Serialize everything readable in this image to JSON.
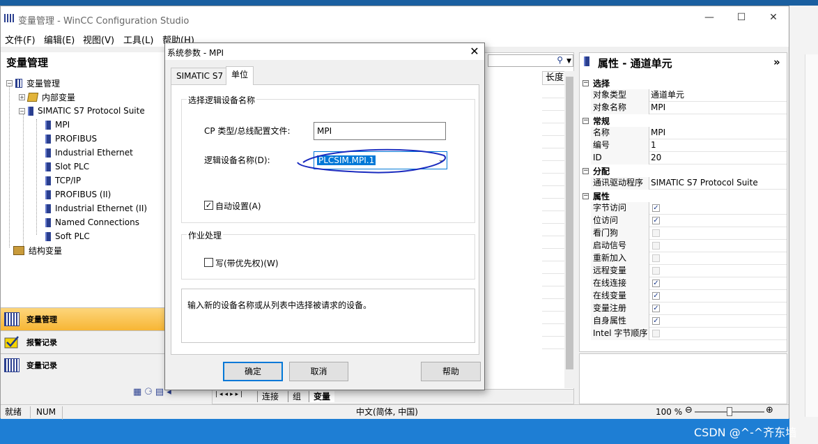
{
  "window": {
    "title": "变量管理 - WinCC Configuration Studio",
    "minimize": "—",
    "maximize": "☐",
    "close": "✕"
  },
  "menu": [
    "文件(F)",
    "编辑(E)",
    "视图(V)",
    "工具(L)",
    "帮助(H)"
  ],
  "left_panel": {
    "header": "变量管理",
    "tree": [
      {
        "label": "变量管理",
        "icon": "tag-management-icon"
      },
      {
        "label": "内部变量",
        "icon": "internal-tags-icon"
      },
      {
        "label": "SIMATIC S7 Protocol Suite",
        "icon": "driver-icon"
      },
      {
        "label": "MPI",
        "icon": "channel-icon"
      },
      {
        "label": "PROFIBUS",
        "icon": "channel-icon"
      },
      {
        "label": "Industrial Ethernet",
        "icon": "channel-icon"
      },
      {
        "label": "Slot PLC",
        "icon": "channel-icon"
      },
      {
        "label": "TCP/IP",
        "icon": "channel-icon"
      },
      {
        "label": "PROFIBUS (II)",
        "icon": "channel-icon"
      },
      {
        "label": "Industrial Ethernet (II)",
        "icon": "channel-icon"
      },
      {
        "label": "Named Connections",
        "icon": "channel-icon"
      },
      {
        "label": "Soft PLC",
        "icon": "channel-icon"
      },
      {
        "label": "结构变量",
        "icon": "structure-tags-icon"
      }
    ],
    "nav": [
      "变量管理",
      "报警记录",
      "变量记录"
    ]
  },
  "center": {
    "column_header": "长度",
    "tabs": [
      "连接",
      "组",
      "变量"
    ]
  },
  "properties": {
    "header": "属性 - 通道单元",
    "expand": "»",
    "sections": {
      "select": "选择",
      "general": "常规",
      "assignment": "分配",
      "attributes": "属性"
    },
    "rows": {
      "object_type_k": "对象类型",
      "object_type_v": "通道单元",
      "object_name_k": "对象名称",
      "object_name_v": "MPI",
      "name_k": "名称",
      "name_v": "MPI",
      "number_k": "编号",
      "number_v": "1",
      "id_k": "ID",
      "id_v": "20",
      "driver_k": "通讯驱动程序",
      "driver_v": "SIMATIC S7 Protocol Suite"
    },
    "flags": [
      {
        "label": "字节访问",
        "checked": true
      },
      {
        "label": "位访问",
        "checked": true
      },
      {
        "label": "看门狗",
        "checked": false
      },
      {
        "label": "启动信号",
        "checked": false
      },
      {
        "label": "重新加入",
        "checked": false
      },
      {
        "label": "远程变量",
        "checked": false
      },
      {
        "label": "在线连接",
        "checked": true
      },
      {
        "label": "在线变量",
        "checked": true
      },
      {
        "label": "变量注册",
        "checked": true
      },
      {
        "label": "自身属性",
        "checked": true
      },
      {
        "label": "Intel 字节顺序",
        "checked": false
      }
    ]
  },
  "status": {
    "ready": "就绪",
    "num": "NUM",
    "lang": "中文(简体, 中国)",
    "zoom": "100 %"
  },
  "dialog": {
    "title": "系统参数 - MPI",
    "close": "✕",
    "tabs": [
      "SIMATIC S7",
      "单位"
    ],
    "group1": "选择逻辑设备名称",
    "cp_label": "CP 类型/总线配置文件:",
    "cp_value": "MPI",
    "logical_label": "逻辑设备名称(D):",
    "logical_value": "PLCSIM.MPI.1",
    "auto_label": "自动设置(A)",
    "group2": "作业处理",
    "write_label": "写(带优先权)(W)",
    "hint": "输入新的设备名称或从列表中选择被请求的设备。",
    "ok": "确定",
    "cancel": "取消",
    "help": "帮助"
  },
  "watermark": "CSDN @^-^齐东墙",
  "colors": {
    "accent": "#0078d7",
    "nav_active": "#f7b634",
    "desktop": "#1e7ed4"
  }
}
